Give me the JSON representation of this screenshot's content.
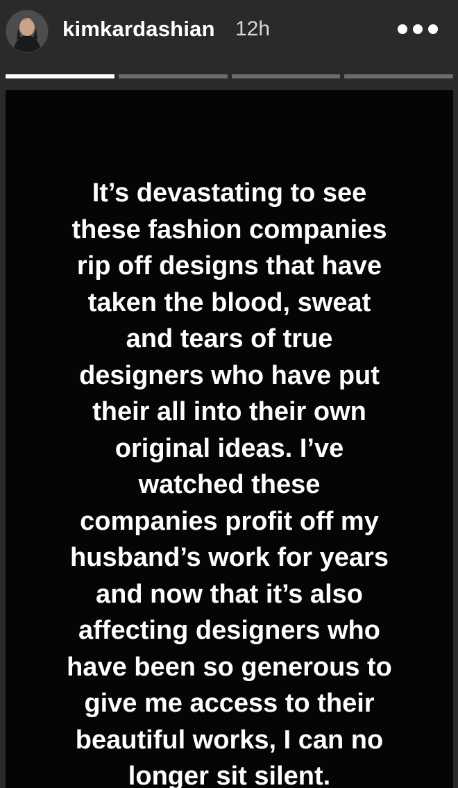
{
  "header": {
    "username": "kimkardashian",
    "timestamp": "12h",
    "avatar_icon": "profile-photo",
    "more_icon": "more-horizontal-icon"
  },
  "progress": {
    "segments": 4,
    "active_segment": 1
  },
  "story": {
    "text": "It’s devastating to see\nthese fashion companies\nrip off designs that have\ntaken the blood, sweat\nand tears of true\ndesigners who have put\ntheir all into their own\noriginal ideas. I’ve\nwatched these\ncompanies profit off my\nhusband’s work for years\nand now that it’s also\naffecting designers who\nhave been so generous to\ngive me access to their\nbeautiful works, I can no\nlonger sit silent."
  },
  "colors": {
    "header_background": "#2a2a2c",
    "story_background": "#050505",
    "text": "#ffffff",
    "progress_inactive": "#6b6b6d"
  }
}
